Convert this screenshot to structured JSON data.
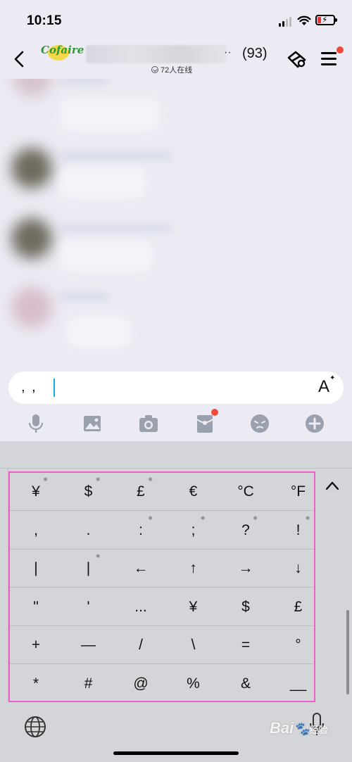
{
  "status_bar": {
    "time": "10:15"
  },
  "header": {
    "back_icon": "chevron-left-icon",
    "logo_text": "Cofaire",
    "title_suffix": "··",
    "member_count": "(93)",
    "online_text": "72人在线",
    "menu_badge_color": "#f04b3a"
  },
  "input": {
    "text": ", ,",
    "font_button": "A"
  },
  "toolbar": {
    "items": [
      "microphone-icon",
      "image-icon",
      "camera-icon",
      "red-packet-icon",
      "emoji-icon",
      "add-icon"
    ],
    "badge_color": "#f04b3a"
  },
  "keyboard": {
    "highlight_color": "#f05fc8",
    "rows": [
      [
        {
          "s": "¥",
          "h": "⁕"
        },
        {
          "s": "$",
          "h": "⁕"
        },
        {
          "s": "£",
          "h": "⁕"
        },
        {
          "s": "€",
          "h": ""
        },
        {
          "s": "°C",
          "h": ""
        },
        {
          "s": "°F",
          "h": ""
        }
      ],
      [
        {
          "s": ",",
          "h": ""
        },
        {
          "s": ".",
          "h": ""
        },
        {
          "s": ":",
          "h": "⁕"
        },
        {
          "s": ";",
          "h": "⁕"
        },
        {
          "s": "?",
          "h": "⁕"
        },
        {
          "s": "!",
          "h": "⁕"
        }
      ],
      [
        {
          "s": "|",
          "h": ""
        },
        {
          "s": "|",
          "h": "⁕"
        },
        {
          "s": "←",
          "h": ""
        },
        {
          "s": "↑",
          "h": ""
        },
        {
          "s": "→",
          "h": ""
        },
        {
          "s": "↓",
          "h": ""
        }
      ],
      [
        {
          "s": "\"",
          "h": ""
        },
        {
          "s": "'",
          "h": ""
        },
        {
          "s": "...",
          "h": ""
        },
        {
          "s": "¥",
          "h": ""
        },
        {
          "s": "$",
          "h": ""
        },
        {
          "s": "£",
          "h": ""
        }
      ],
      [
        {
          "s": "+",
          "h": ""
        },
        {
          "s": "—",
          "h": ""
        },
        {
          "s": "/",
          "h": ""
        },
        {
          "s": "\\",
          "h": ""
        },
        {
          "s": "=",
          "h": ""
        },
        {
          "s": "°",
          "h": ""
        }
      ],
      [
        {
          "s": "*",
          "h": ""
        },
        {
          "s": "#",
          "h": ""
        },
        {
          "s": "@",
          "h": ""
        },
        {
          "s": "%",
          "h": ""
        },
        {
          "s": "&",
          "h": ""
        },
        {
          "s": "__",
          "h": ""
        }
      ]
    ]
  },
  "watermark": {
    "brand": "Bai",
    "suffix": "经验"
  }
}
